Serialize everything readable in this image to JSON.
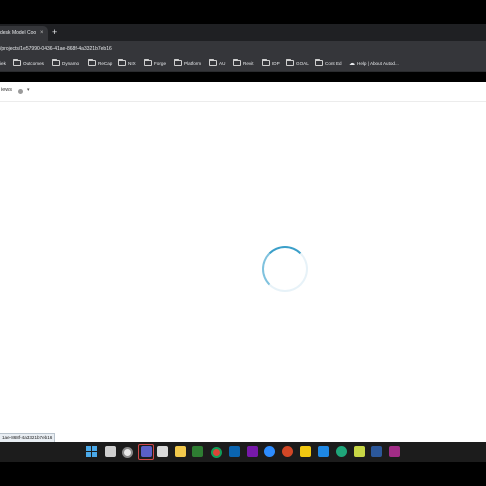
{
  "browser": {
    "tab_title": "desk Model Coo",
    "tab_close": "×",
    "new_tab": "+",
    "url": "/projects/1e57990-0436-41ae-868f-4a3321b7eb16"
  },
  "bookmarks": [
    {
      "label": "iek",
      "icon": "none"
    },
    {
      "label": "Outcomes",
      "icon": "folder-icon"
    },
    {
      "label": "Dynamo",
      "icon": "folder-icon"
    },
    {
      "label": "ReCap",
      "icon": "folder-icon"
    },
    {
      "label": "NIX",
      "icon": "folder-icon"
    },
    {
      "label": "Forge",
      "icon": "folder-icon"
    },
    {
      "label": "Platform",
      "icon": "folder-icon"
    },
    {
      "label": "AU",
      "icon": "folder-icon"
    },
    {
      "label": "Revit",
      "icon": "folder-icon"
    },
    {
      "label": "IDP",
      "icon": "folder-icon"
    },
    {
      "label": "GOAL",
      "icon": "folder-icon"
    },
    {
      "label": "Cont Ed",
      "icon": "folder-icon"
    },
    {
      "label": "Help | About Autod...",
      "icon": "cloud-icon"
    }
  ],
  "page": {
    "views_label": "iews",
    "views_caret": "▾",
    "loading": true
  },
  "status_bar": {
    "link": "1ae-868f-4a3321b7eb16"
  },
  "taskbar": {
    "icons": [
      "start-icon",
      "search-icon",
      "task-view-icon",
      "chrome-icon",
      "teams-icon",
      "notes-icon",
      "file-explorer-icon",
      "notepad-icon",
      "excel-icon",
      "chrome-icon",
      "outlook-icon",
      "onenote-icon",
      "zoom-icon",
      "powerpoint-icon",
      "power-bi-icon",
      "azure-icon",
      "edge-icon",
      "word-icon",
      "sticky-notes-icon",
      "calculator-icon",
      "onenote-icon"
    ]
  },
  "colors": {
    "spinner_accent": "#3b9fc9",
    "chrome_dark": "#35363a"
  }
}
